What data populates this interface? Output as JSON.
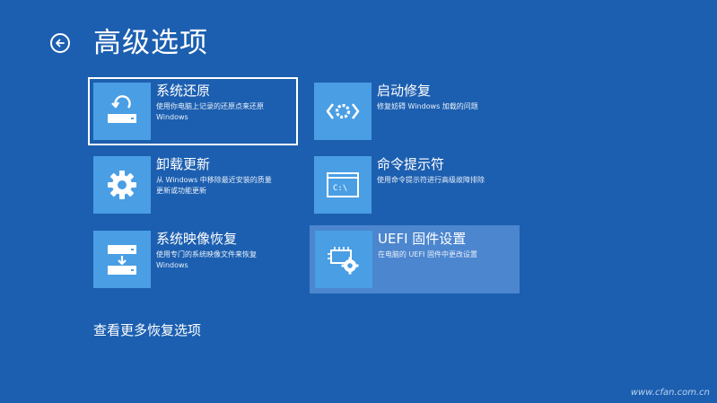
{
  "header": {
    "title": "高级选项",
    "back_icon": "back-arrow-circle-icon"
  },
  "options": [
    {
      "id": "system-restore",
      "icon": "system-restore-icon",
      "title": "系统还原",
      "desc_line1": "使用你电脑上记录的还原点来还原",
      "desc_line2": "Windows",
      "state": "focused"
    },
    {
      "id": "startup-repair",
      "icon": "startup-repair-icon",
      "title": "启动修复",
      "desc_line1": "修复妨碍 Windows 加载的问题",
      "desc_line2": "",
      "state": "normal"
    },
    {
      "id": "uninstall-updates",
      "icon": "gear-icon",
      "title": "卸载更新",
      "desc_line1": "从 Windows 中移除最近安装的质量",
      "desc_line2": "更新或功能更新",
      "state": "normal"
    },
    {
      "id": "command-prompt",
      "icon": "command-prompt-icon",
      "title": "命令提示符",
      "desc_line1": "使用命令提示符进行高级故障排除",
      "desc_line2": "",
      "state": "normal"
    },
    {
      "id": "system-image-recovery",
      "icon": "system-image-recovery-icon",
      "title": "系统映像恢复",
      "desc_line1": "使用专门的系统映像文件来恢复",
      "desc_line2": "Windows",
      "state": "normal"
    },
    {
      "id": "uefi-firmware-settings",
      "icon": "uefi-firmware-icon",
      "title": "UEFI 固件设置",
      "desc_line1": "在电脑的 UEFI 固件中更改设置",
      "desc_line2": "",
      "state": "hovered"
    }
  ],
  "more_link": "查看更多恢复选项",
  "watermark": "www.cfan.com.cn",
  "colors": {
    "background": "#1c5fb0",
    "icon_tile": "#4a9ee4",
    "hover_tile": "#4c86cf",
    "text": "#ffffff"
  }
}
